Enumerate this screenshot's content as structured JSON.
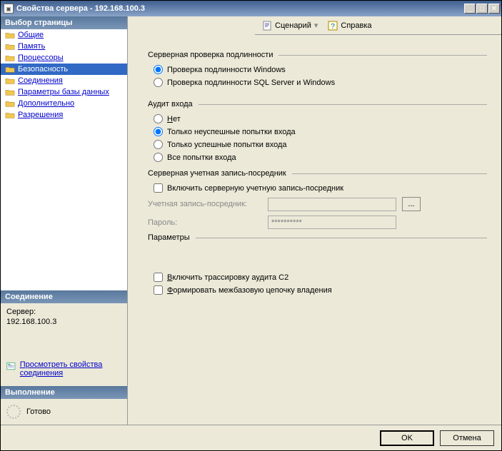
{
  "title": "Свойства сервера - 192.168.100.3",
  "toolbar": {
    "script": "Сценарий",
    "help": "Справка"
  },
  "sidebar": {
    "select_header": "Выбор страницы",
    "items": [
      {
        "label": "Общие"
      },
      {
        "label": "Память"
      },
      {
        "label": "Процессоры"
      },
      {
        "label": "Безопасность"
      },
      {
        "label": "Соединения"
      },
      {
        "label": "Параметры базы данных"
      },
      {
        "label": "Дополнительно"
      },
      {
        "label": "Разрешения"
      }
    ],
    "connection_header": "Соединение",
    "server_label": "Сервер:",
    "server_value": "192.168.100.3",
    "view_connection": "Просмотреть свойства соединения",
    "exec_header": "Выполнение",
    "exec_status": "Готово"
  },
  "content": {
    "auth_group": "Серверная проверка подлинности",
    "auth_windows": "Проверка подлинности Windows",
    "auth_sql": "Проверка подлинности SQL Server и Windows",
    "audit_group": "Аудит входа",
    "audit_none_pre": "Н",
    "audit_none_rest": "ет",
    "audit_failed": "Только неуспешные попытки входа",
    "audit_success": "Только успешные попытки входа",
    "audit_all": "Все попытки входа",
    "proxy_group": "Серверная учетная запись-посредник",
    "proxy_enable": "Включить серверную учетную запись-посредник",
    "proxy_account": "Учетная запись-посредник:",
    "proxy_password": "Пароль:",
    "proxy_pwd_placeholder": "**********",
    "params_group": "Параметры",
    "c2_pre": "В",
    "c2_rest": "ключить трассировку аудита C2",
    "chain_pre": "Ф",
    "chain_rest": "ормировать межбазовую цепочку владения"
  },
  "footer": {
    "ok": "OK",
    "cancel": "Отмена"
  }
}
